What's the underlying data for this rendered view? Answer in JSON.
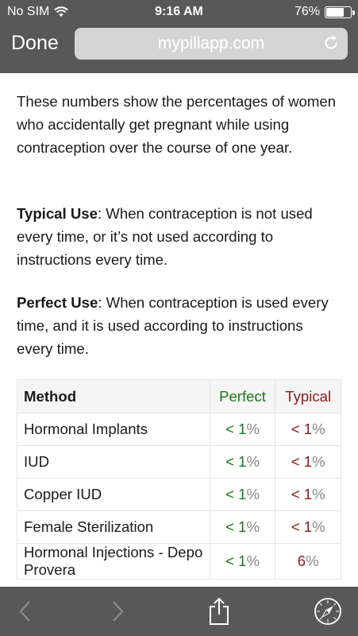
{
  "status": {
    "carrier": "No SIM",
    "time": "9:16 AM",
    "battery": "76%",
    "battery_level": 0.76
  },
  "nav": {
    "done_label": "Done",
    "url": "mypillapp.com"
  },
  "intro": "These numbers show the percentages of women who accidentally get pregnant while using contraception over the course of one year.",
  "typical": {
    "term": "Typical Use",
    "text": ": When contraception is not used every time, or it’s not used according to instructions every time."
  },
  "perfect": {
    "term": "Perfect Use",
    "text": ": When contraception is used every time, and it is used according to instructions every time."
  },
  "table": {
    "headers": {
      "method": "Method",
      "perfect": "Perfect",
      "typical": "Typical"
    },
    "rows": [
      {
        "method": "Hormonal Implants",
        "perfect": {
          "value": "< 1",
          "unit": "%"
        },
        "typical": {
          "value": "< 1",
          "unit": "%"
        }
      },
      {
        "method": "IUD",
        "perfect": {
          "value": "< 1",
          "unit": "%"
        },
        "typical": {
          "value": "< 1",
          "unit": "%"
        }
      },
      {
        "method": "Copper IUD",
        "perfect": {
          "value": "< 1",
          "unit": "%"
        },
        "typical": {
          "value": "< 1",
          "unit": "%"
        }
      },
      {
        "method": "Female Sterilization",
        "perfect": {
          "value": "< 1",
          "unit": "%"
        },
        "typical": {
          "value": "< 1",
          "unit": "%"
        }
      },
      {
        "method": "Hormonal Injections - Depo Provera",
        "perfect": {
          "value": "< 1",
          "unit": "%"
        },
        "typical": {
          "value": "6",
          "unit": "%"
        }
      }
    ]
  },
  "toolbar": {
    "icons": [
      "back-icon",
      "forward-icon",
      "share-icon",
      "compass-icon"
    ]
  }
}
